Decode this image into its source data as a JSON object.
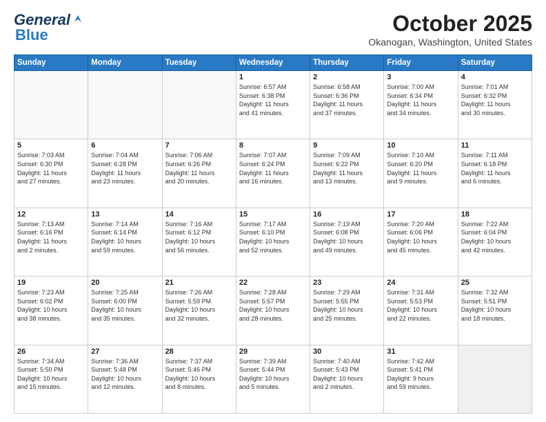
{
  "header": {
    "logo_line1": "General",
    "logo_line2": "Blue",
    "month": "October 2025",
    "location": "Okanogan, Washington, United States"
  },
  "weekdays": [
    "Sunday",
    "Monday",
    "Tuesday",
    "Wednesday",
    "Thursday",
    "Friday",
    "Saturday"
  ],
  "weeks": [
    [
      {
        "day": "",
        "info": ""
      },
      {
        "day": "",
        "info": ""
      },
      {
        "day": "",
        "info": ""
      },
      {
        "day": "1",
        "info": "Sunrise: 6:57 AM\nSunset: 6:38 PM\nDaylight: 11 hours\nand 41 minutes."
      },
      {
        "day": "2",
        "info": "Sunrise: 6:58 AM\nSunset: 6:36 PM\nDaylight: 11 hours\nand 37 minutes."
      },
      {
        "day": "3",
        "info": "Sunrise: 7:00 AM\nSunset: 6:34 PM\nDaylight: 11 hours\nand 34 minutes."
      },
      {
        "day": "4",
        "info": "Sunrise: 7:01 AM\nSunset: 6:32 PM\nDaylight: 11 hours\nand 30 minutes."
      }
    ],
    [
      {
        "day": "5",
        "info": "Sunrise: 7:03 AM\nSunset: 6:30 PM\nDaylight: 11 hours\nand 27 minutes."
      },
      {
        "day": "6",
        "info": "Sunrise: 7:04 AM\nSunset: 6:28 PM\nDaylight: 11 hours\nand 23 minutes."
      },
      {
        "day": "7",
        "info": "Sunrise: 7:06 AM\nSunset: 6:26 PM\nDaylight: 11 hours\nand 20 minutes."
      },
      {
        "day": "8",
        "info": "Sunrise: 7:07 AM\nSunset: 6:24 PM\nDaylight: 11 hours\nand 16 minutes."
      },
      {
        "day": "9",
        "info": "Sunrise: 7:09 AM\nSunset: 6:22 PM\nDaylight: 11 hours\nand 13 minutes."
      },
      {
        "day": "10",
        "info": "Sunrise: 7:10 AM\nSunset: 6:20 PM\nDaylight: 11 hours\nand 9 minutes."
      },
      {
        "day": "11",
        "info": "Sunrise: 7:11 AM\nSunset: 6:18 PM\nDaylight: 11 hours\nand 6 minutes."
      }
    ],
    [
      {
        "day": "12",
        "info": "Sunrise: 7:13 AM\nSunset: 6:16 PM\nDaylight: 11 hours\nand 2 minutes."
      },
      {
        "day": "13",
        "info": "Sunrise: 7:14 AM\nSunset: 6:14 PM\nDaylight: 10 hours\nand 59 minutes."
      },
      {
        "day": "14",
        "info": "Sunrise: 7:16 AM\nSunset: 6:12 PM\nDaylight: 10 hours\nand 56 minutes."
      },
      {
        "day": "15",
        "info": "Sunrise: 7:17 AM\nSunset: 6:10 PM\nDaylight: 10 hours\nand 52 minutes."
      },
      {
        "day": "16",
        "info": "Sunrise: 7:19 AM\nSunset: 6:08 PM\nDaylight: 10 hours\nand 49 minutes."
      },
      {
        "day": "17",
        "info": "Sunrise: 7:20 AM\nSunset: 6:06 PM\nDaylight: 10 hours\nand 45 minutes."
      },
      {
        "day": "18",
        "info": "Sunrise: 7:22 AM\nSunset: 6:04 PM\nDaylight: 10 hours\nand 42 minutes."
      }
    ],
    [
      {
        "day": "19",
        "info": "Sunrise: 7:23 AM\nSunset: 6:02 PM\nDaylight: 10 hours\nand 38 minutes."
      },
      {
        "day": "20",
        "info": "Sunrise: 7:25 AM\nSunset: 6:00 PM\nDaylight: 10 hours\nand 35 minutes."
      },
      {
        "day": "21",
        "info": "Sunrise: 7:26 AM\nSunset: 5:59 PM\nDaylight: 10 hours\nand 32 minutes."
      },
      {
        "day": "22",
        "info": "Sunrise: 7:28 AM\nSunset: 5:57 PM\nDaylight: 10 hours\nand 28 minutes."
      },
      {
        "day": "23",
        "info": "Sunrise: 7:29 AM\nSunset: 5:55 PM\nDaylight: 10 hours\nand 25 minutes."
      },
      {
        "day": "24",
        "info": "Sunrise: 7:31 AM\nSunset: 5:53 PM\nDaylight: 10 hours\nand 22 minutes."
      },
      {
        "day": "25",
        "info": "Sunrise: 7:32 AM\nSunset: 5:51 PM\nDaylight: 10 hours\nand 18 minutes."
      }
    ],
    [
      {
        "day": "26",
        "info": "Sunrise: 7:34 AM\nSunset: 5:50 PM\nDaylight: 10 hours\nand 15 minutes."
      },
      {
        "day": "27",
        "info": "Sunrise: 7:36 AM\nSunset: 5:48 PM\nDaylight: 10 hours\nand 12 minutes."
      },
      {
        "day": "28",
        "info": "Sunrise: 7:37 AM\nSunset: 5:46 PM\nDaylight: 10 hours\nand 8 minutes."
      },
      {
        "day": "29",
        "info": "Sunrise: 7:39 AM\nSunset: 5:44 PM\nDaylight: 10 hours\nand 5 minutes."
      },
      {
        "day": "30",
        "info": "Sunrise: 7:40 AM\nSunset: 5:43 PM\nDaylight: 10 hours\nand 2 minutes."
      },
      {
        "day": "31",
        "info": "Sunrise: 7:42 AM\nSunset: 5:41 PM\nDaylight: 9 hours\nand 59 minutes."
      },
      {
        "day": "",
        "info": ""
      }
    ]
  ]
}
